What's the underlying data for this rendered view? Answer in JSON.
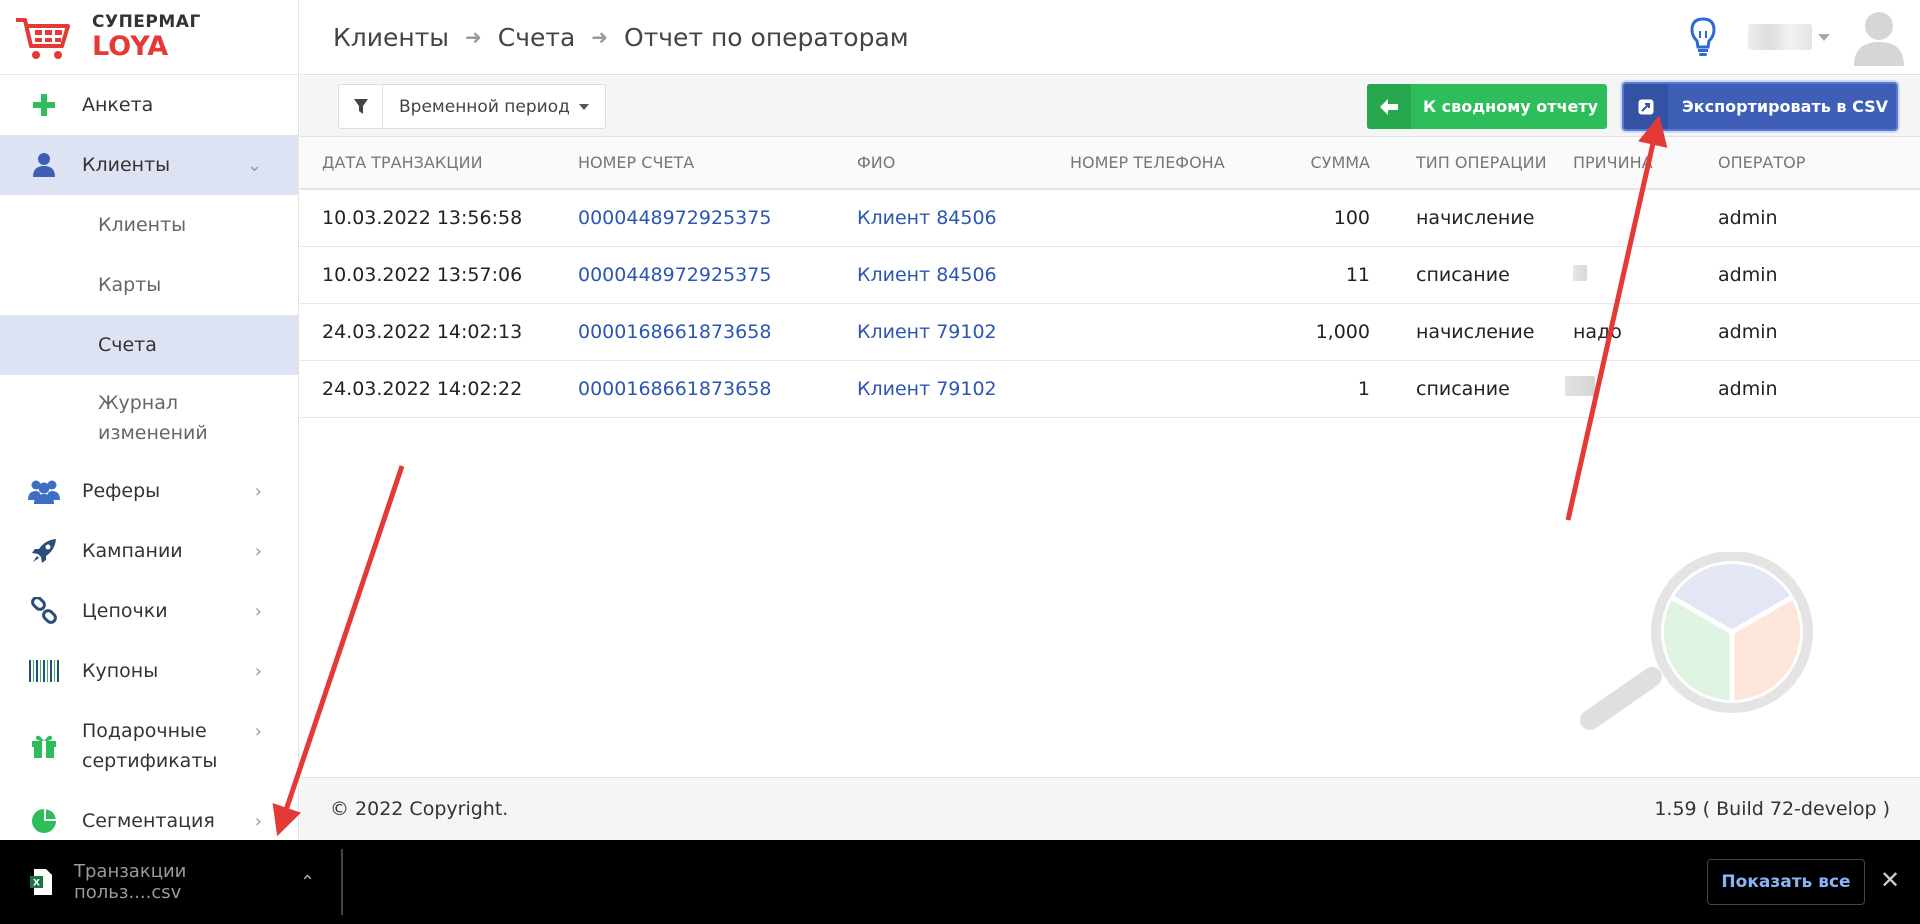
{
  "logo": {
    "top": "СУПЕРМАГ",
    "bottom": "LOYA"
  },
  "sidebar": {
    "items": [
      {
        "label": "Анкета",
        "icon": "plus-icon"
      },
      {
        "label": "Клиенты",
        "icon": "user-icon"
      },
      {
        "label": "Клиенты"
      },
      {
        "label": "Карты"
      },
      {
        "label": "Счета"
      },
      {
        "label": "Журнал изменений"
      },
      {
        "label": "Реферы",
        "icon": "users-icon"
      },
      {
        "label": "Кампании",
        "icon": "rocket-icon"
      },
      {
        "label": "Цепочки",
        "icon": "chain-icon"
      },
      {
        "label": "Купоны",
        "icon": "barcode-icon"
      },
      {
        "label": "Подарочные сертификаты",
        "icon": "gift-icon"
      },
      {
        "label": "Сегментация",
        "icon": "pie-icon"
      }
    ]
  },
  "breadcrumb": [
    "Клиенты",
    "Счета",
    "Отчет по операторам"
  ],
  "toolbar": {
    "period_label": "Временной период",
    "summary_button": "К сводному отчету",
    "export_button": "Экспортировать в CSV"
  },
  "table": {
    "headers": [
      "Дата транзакции",
      "Номер счета",
      "ФИО",
      "Номер телефона",
      "Сумма",
      "Тип операции",
      "Причина",
      "Оператор"
    ],
    "rows": [
      [
        "10.03.2022 13:56:58",
        "0000448972925375",
        "Клиент 84506",
        "",
        "100",
        "начисление",
        "",
        "admin"
      ],
      [
        "10.03.2022 13:57:06",
        "0000448972925375",
        "Клиент 84506",
        "",
        "11",
        "списание",
        "",
        "admin"
      ],
      [
        "24.03.2022 14:02:13",
        "0000168661873658",
        "Клиент 79102",
        "",
        "1,000",
        "начисление",
        "надо",
        "admin"
      ],
      [
        "24.03.2022 14:02:22",
        "0000168661873658",
        "Клиент 79102",
        "",
        "1",
        "списание",
        "",
        "admin"
      ]
    ]
  },
  "footer": {
    "copyright": "© 2022 Copyright.",
    "version": "1.59 ( Build 72-develop )"
  },
  "downloads": {
    "file_name": "Транзакции польз....csv",
    "show_all": "Показать все"
  },
  "colors": {
    "accent_blue": "#3f5fb7",
    "accent_green": "#2ebd5b",
    "link": "#2c56b5",
    "brand_red": "#e53935",
    "annotation_arrow": "#e53935"
  }
}
